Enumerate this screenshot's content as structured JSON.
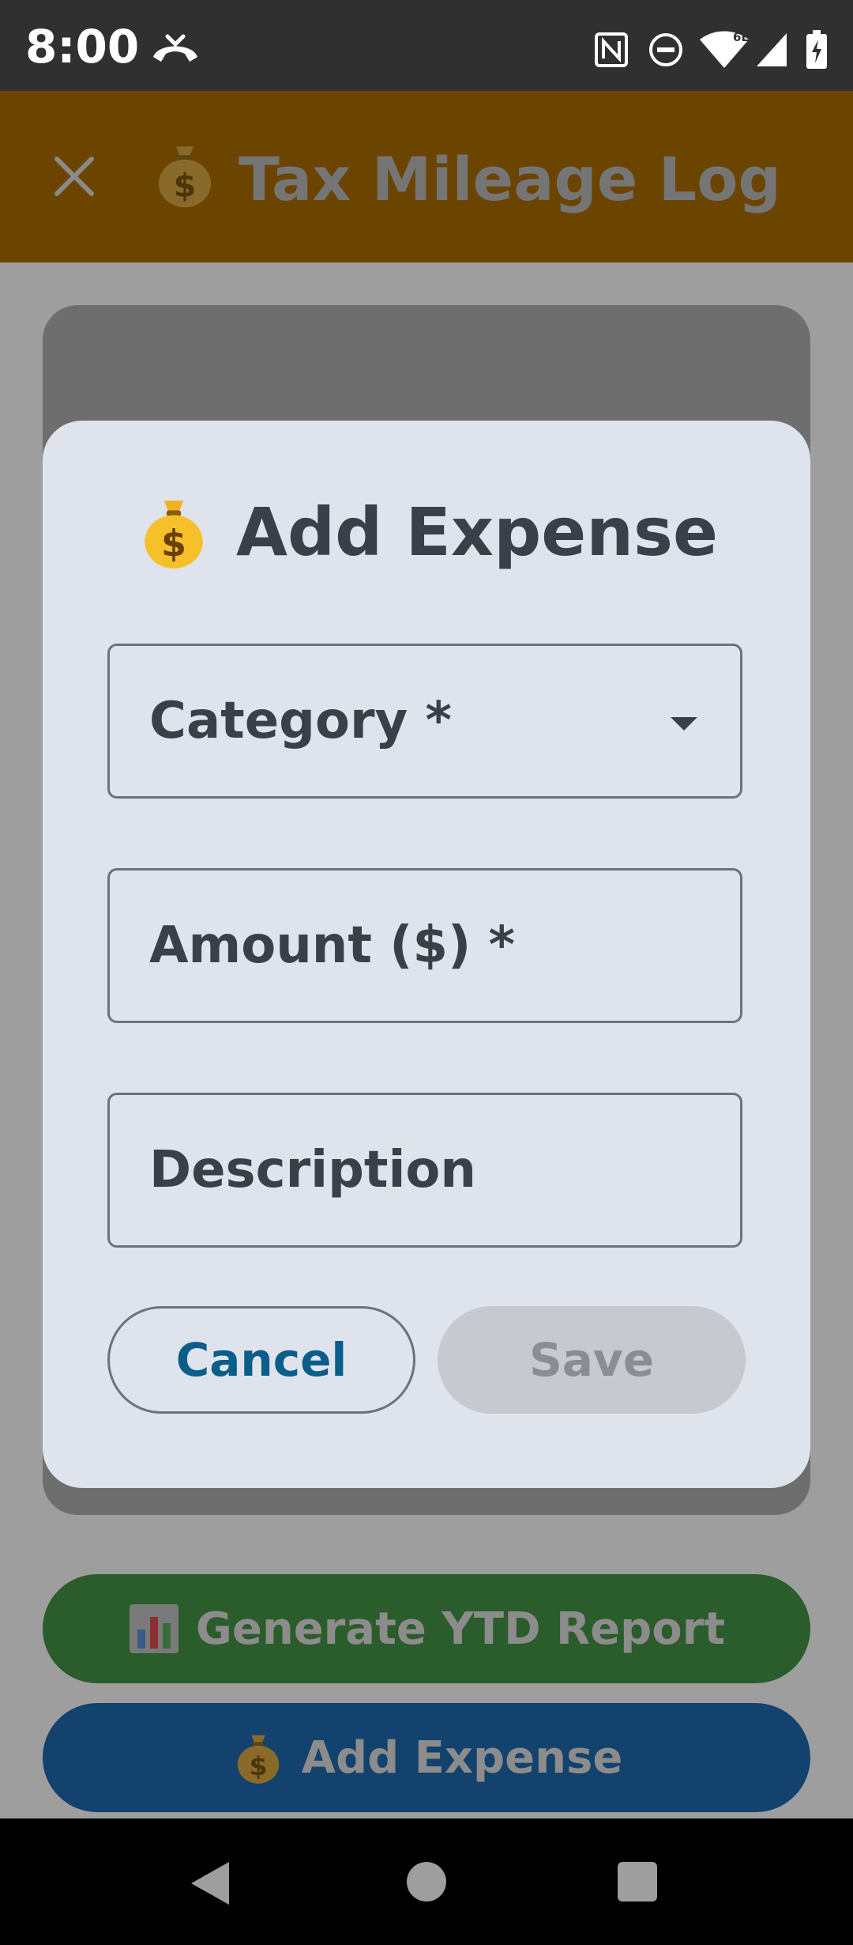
{
  "status_bar": {
    "time": "8:00",
    "network_badge": "6E"
  },
  "toolbar": {
    "title": "Tax Mileage Log",
    "title_icon": "money-bag-icon",
    "color": "#6b4500"
  },
  "dialog": {
    "title": "Add Expense",
    "title_icon": "money-bag-icon",
    "fields": {
      "category": {
        "label": "Category *",
        "value": ""
      },
      "amount": {
        "label": "Amount ($) *",
        "value": ""
      },
      "description": {
        "label": "Description",
        "value": ""
      }
    },
    "buttons": {
      "cancel": "Cancel",
      "save": "Save"
    },
    "accent_color": "#0b5d8a"
  },
  "background_actions": {
    "report_label": "Generate YTD Report",
    "report_icon": "bar-chart-icon",
    "report_color": "#2b5c2b",
    "expense_label": "Add Expense",
    "expense_icon": "money-bag-icon",
    "expense_color": "#12426d"
  },
  "icons": {
    "call": "call-end-icon",
    "nfc": "nfc-icon",
    "dnd": "do-not-disturb-icon",
    "wifi": "wifi-icon",
    "signal": "cell-signal-icon",
    "battery": "battery-charging-icon",
    "nav_back": "back-icon",
    "nav_home": "home-icon",
    "nav_recents": "recents-icon"
  }
}
